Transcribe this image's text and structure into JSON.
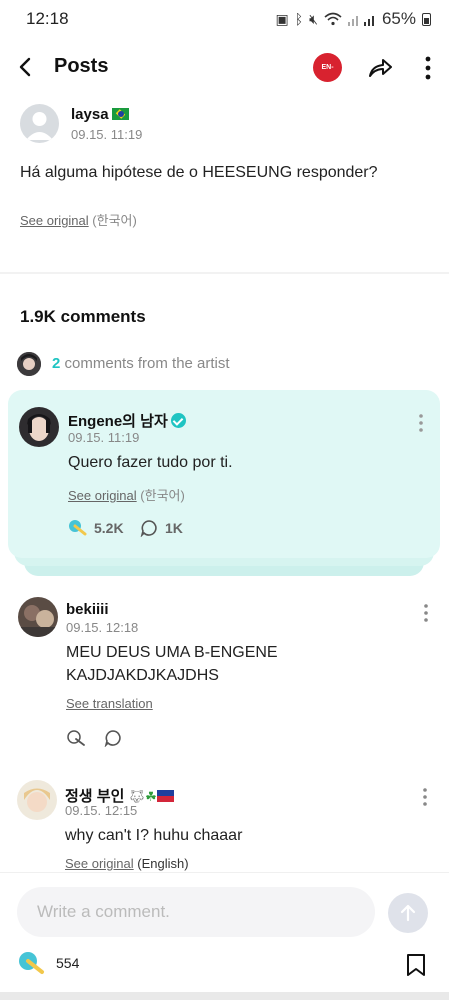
{
  "status_bar": {
    "time": "12:18",
    "battery": "65%"
  },
  "header": {
    "title": "Posts",
    "channel_badge": "EN-"
  },
  "post": {
    "author_name": "laysa",
    "date": "09.15. 11:19",
    "body": "Há alguma hipótese de o HEESEUNG responder?",
    "see_original": "See original",
    "original_lang": "(한국어)"
  },
  "comments_section": {
    "count_label": "1.9K comments",
    "artist_count": "2",
    "artist_label": "comments from the artist"
  },
  "comments": [
    {
      "name": "Engene의 남자",
      "date": "09.15. 11:19",
      "text": "Quero fazer tudo por ti.",
      "link": "See original",
      "lang": "(한국어)",
      "likes": "5.2K",
      "replies": "1K"
    },
    {
      "name": "bekiiii",
      "date": "09.15. 12:18",
      "text_line1": "MEU DEUS UMA B-ENGENE",
      "text_line2": "KAJDJAKDJKAJDHS",
      "link": "See translation"
    },
    {
      "name": "정생 부인",
      "date": "09.15. 12:15",
      "text": "why can't I? huhu chaaar",
      "link": "See original",
      "lang": "(English)"
    }
  ],
  "bottom_bar": {
    "input_placeholder": "Write a comment.",
    "likes": "554"
  },
  "colors": {
    "accent": "#1fc4c2",
    "artist_card_bg": "#e0f8f5",
    "badge_red": "#d8222f"
  }
}
